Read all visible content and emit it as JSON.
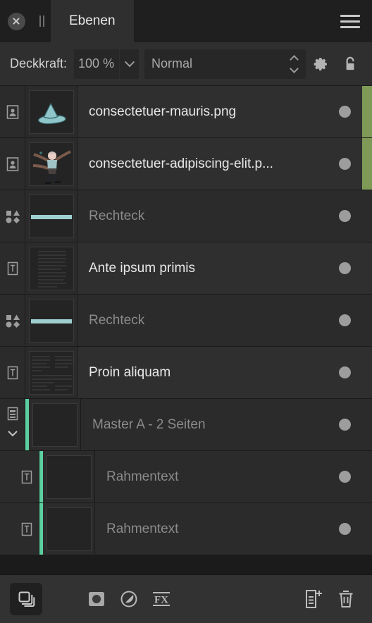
{
  "window": {
    "tab_title": "Ebenen",
    "close_icon": "close-icon",
    "grip_icon": "panel-grip-icon",
    "menu_icon": "hamburger-menu-icon"
  },
  "options": {
    "opacity_label": "Deckkraft:",
    "opacity_value": "100 %",
    "opacity_placeholder": "100 %",
    "opacity_dropdown_icon": "chevron-down-icon",
    "blend_mode": "Normal",
    "blend_stepper_icon": "stepper-updown-icon",
    "settings_icon": "gear-icon",
    "lock_icon": "lock-open-icon"
  },
  "colors": {
    "selection_green": "#7f9a57",
    "master_teal": "#5ccfa0",
    "shape_accent": "#9ed0d2",
    "panel_bg": "#2b2b2b",
    "row_bg": "#2f2f2f",
    "text_primary": "#e9e9e9",
    "text_dim": "#8b8b8b"
  },
  "layers": [
    {
      "name": "consectetuer-mauris.png",
      "type_icon": "image-layer-icon",
      "thumb": "hat",
      "dim": false,
      "indent": false,
      "selected": true,
      "master_bar": false,
      "expander": false,
      "visible": true
    },
    {
      "name": "consectetuer-adipiscing-elit.p...",
      "type_icon": "image-layer-icon",
      "thumb": "figure",
      "dim": false,
      "indent": false,
      "selected": true,
      "master_bar": false,
      "expander": false,
      "visible": true
    },
    {
      "name": "Rechteck",
      "type_icon": "shape-layer-icon",
      "thumb": "shape",
      "dim": true,
      "indent": false,
      "selected": false,
      "master_bar": false,
      "expander": false,
      "visible": true
    },
    {
      "name": "Ante ipsum primis",
      "type_icon": "text-layer-icon",
      "thumb": "text-single",
      "dim": false,
      "indent": false,
      "selected": false,
      "master_bar": false,
      "expander": false,
      "visible": true
    },
    {
      "name": "Rechteck",
      "type_icon": "shape-layer-icon",
      "thumb": "shape",
      "dim": true,
      "indent": false,
      "selected": false,
      "master_bar": false,
      "expander": false,
      "visible": true
    },
    {
      "name": "Proin aliquam",
      "type_icon": "text-layer-icon",
      "thumb": "text-double",
      "dim": false,
      "indent": false,
      "selected": false,
      "master_bar": false,
      "expander": false,
      "visible": true
    },
    {
      "name": "Master A - 2 Seiten",
      "type_icon": "master-page-icon",
      "thumb": "empty",
      "dim": true,
      "indent": false,
      "selected": false,
      "master_bar": true,
      "expander": true,
      "expander_icon": "chevron-down-icon",
      "visible": true
    },
    {
      "name": "Rahmentext",
      "type_icon": "text-layer-icon",
      "thumb": "empty",
      "dim": true,
      "indent": true,
      "selected": false,
      "master_bar": true,
      "expander": false,
      "visible": true
    },
    {
      "name": "Rahmentext",
      "type_icon": "text-layer-icon",
      "thumb": "empty",
      "dim": true,
      "indent": true,
      "selected": false,
      "master_bar": true,
      "expander": false,
      "visible": true
    }
  ],
  "bottom_toolbar": {
    "layers_panel_icon": "layers-stack-icon",
    "mask_icon": "add-mask-icon",
    "adjustment_icon": "adjustment-layer-icon",
    "fx_icon": "layer-effects-fx-icon",
    "new_layer_icon": "new-layer-icon",
    "delete_icon": "trash-icon"
  }
}
